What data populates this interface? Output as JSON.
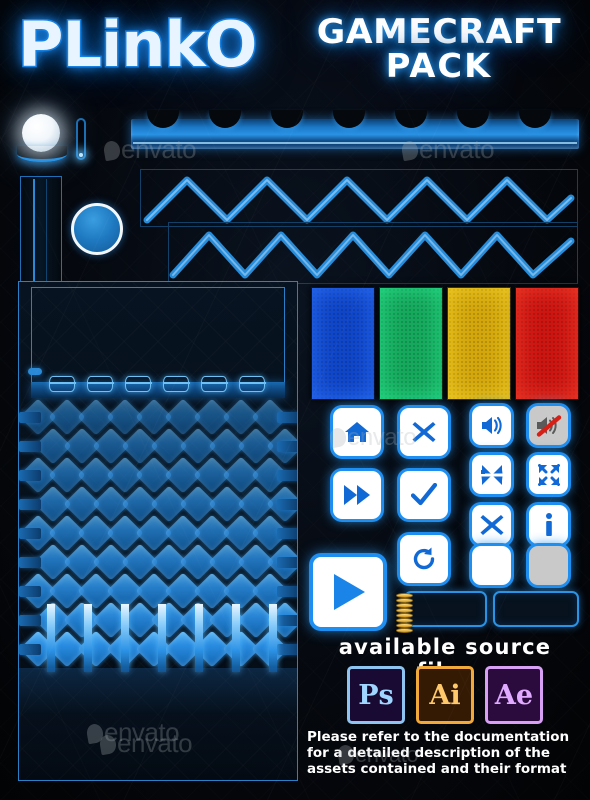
{
  "poster": {
    "title_main": "PLinkO",
    "title_sub_line1": "GAMECRAFT",
    "title_sub_line2": "PACK",
    "watermark_text": "envato"
  },
  "colors": {
    "accent_blue": "#1f8ef1",
    "glow_blue": "#2a93e4",
    "deep_blue": "#0f63ae",
    "background": "#05080e",
    "peg_blue": "#2a8ce0",
    "white": "#ffffff"
  },
  "assets": {
    "ball_label": "plinko-ball",
    "chip_label": "plinko-chip",
    "glow_bar_label": "glow-indicator",
    "frame_label": "side-frame",
    "scallop_bar_label": "scalloped-top-bar",
    "zigzag_label": "zigzag-rail"
  },
  "board": {
    "cups_count": 6,
    "peg_rows": 9,
    "peg_cols": 9,
    "dividers_count": 7
  },
  "cards": [
    {
      "name": "blue-card",
      "fill": "#1046c8",
      "glow": "#2a6ef5"
    },
    {
      "name": "green-card",
      "fill": "#16a85c",
      "glow": "#27e08a"
    },
    {
      "name": "yellow-card",
      "fill": "#d3a70c",
      "glow": "#f2cf28"
    },
    {
      "name": "red-card",
      "fill": "#cc1612",
      "glow": "#f23c2a"
    }
  ],
  "buttons": [
    {
      "id": "home",
      "label": "Home",
      "icon": "home-icon",
      "style": "white",
      "size": "lg"
    },
    {
      "id": "close",
      "label": "Close",
      "icon": "x-icon",
      "style": "white",
      "size": "lg"
    },
    {
      "id": "sound-on",
      "label": "Sound On",
      "icon": "speaker-icon",
      "style": "white",
      "size": "sm"
    },
    {
      "id": "sound-off",
      "label": "Sound Off",
      "icon": "speaker-muted-icon",
      "style": "gray",
      "size": "sm"
    },
    {
      "id": "fast-forward",
      "label": "Fast Forward",
      "icon": "fast-forward-icon",
      "style": "white",
      "size": "lg"
    },
    {
      "id": "confirm",
      "label": "Confirm",
      "icon": "check-icon",
      "style": "white",
      "size": "lg"
    },
    {
      "id": "contract",
      "label": "Exit Fullscreen",
      "icon": "contract-icon",
      "style": "white",
      "size": "sm"
    },
    {
      "id": "expand",
      "label": "Fullscreen",
      "icon": "expand-icon",
      "style": "white",
      "size": "sm"
    },
    {
      "id": "cancel",
      "label": "Cancel",
      "icon": "x-icon",
      "style": "white",
      "size": "sm"
    },
    {
      "id": "info",
      "label": "Info",
      "icon": "info-icon",
      "style": "white",
      "size": "sm"
    },
    {
      "id": "replay",
      "label": "Replay",
      "icon": "refresh-icon",
      "style": "white",
      "size": "lg"
    },
    {
      "id": "blank-white",
      "label": "Blank",
      "icon": "blank-icon",
      "style": "white",
      "size": "sm"
    },
    {
      "id": "blank-gray",
      "label": "Disabled",
      "icon": "blank-icon",
      "style": "gray",
      "size": "sm"
    },
    {
      "id": "play",
      "label": "Play",
      "icon": "play-icon",
      "style": "white",
      "size": "xl"
    }
  ],
  "source_files": {
    "heading": "available source files",
    "items": [
      {
        "name": "photoshop",
        "abbr": "Ps",
        "bg": "#190a33",
        "border": "#8ec5f0",
        "fg": "#9fd5ff"
      },
      {
        "name": "illustrator",
        "abbr": "Ai",
        "bg": "#341a03",
        "border": "#f2a93b",
        "fg": "#ffc86b"
      },
      {
        "name": "after-effects",
        "abbr": "Ae",
        "bg": "#2b0a3d",
        "border": "#d8a0f5",
        "fg": "#dfaaff"
      }
    ]
  },
  "footer": {
    "line1": "Please refer to the documentation",
    "line2": "for a detailed description of the",
    "line3": "assets contained and their format"
  }
}
